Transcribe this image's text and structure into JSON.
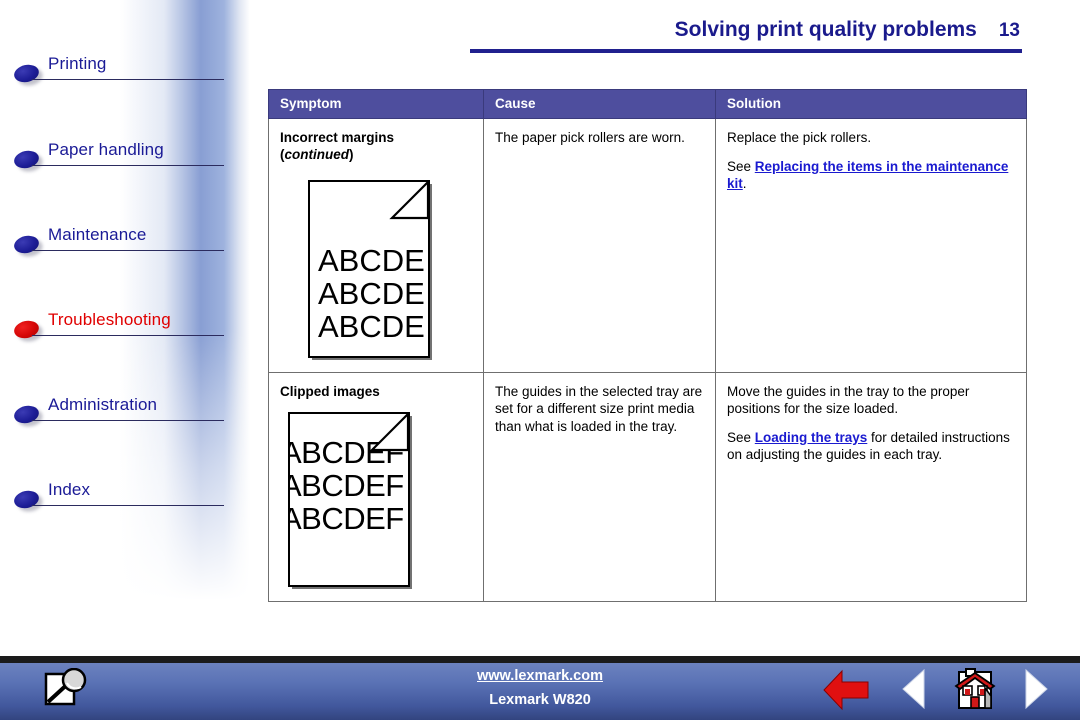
{
  "header": {
    "title": "Solving print quality problems",
    "page_number": "13",
    "accent_color": "#1a1a8c"
  },
  "sidebar": {
    "items": [
      {
        "label": "Printing",
        "state": "normal",
        "icon": "bullet-ellipse-icon"
      },
      {
        "label": "Paper handling",
        "state": "normal",
        "icon": "bullet-ellipse-icon"
      },
      {
        "label": "Maintenance",
        "state": "normal",
        "icon": "bullet-ellipse-icon"
      },
      {
        "label": "Troubleshooting",
        "state": "active",
        "icon": "bullet-ellipse-icon"
      },
      {
        "label": "Administration",
        "state": "normal",
        "icon": "bullet-ellipse-icon"
      },
      {
        "label": "Index",
        "state": "normal",
        "icon": "bullet-ellipse-icon"
      }
    ],
    "normal_color": "#1a1a96",
    "active_color": "#e00000"
  },
  "table": {
    "header_bg": "#4e4e9e",
    "columns": [
      "Symptom",
      "Cause",
      "Solution"
    ],
    "rows": [
      {
        "symptom_title": "Incorrect margins",
        "symptom_title_note": "continued",
        "sample_lines": [
          "ABCDE",
          "ABCDE",
          "ABCDE"
        ],
        "cause": "The paper pick rollers are worn.",
        "solution_text": "Replace the pick rollers.",
        "solution_see_prefix": "See ",
        "solution_link": "Replacing the items in the maintenance kit",
        "solution_see_suffix": "."
      },
      {
        "symptom_title": "Clipped images",
        "symptom_title_note": "",
        "sample_lines": [
          "ABCDEF",
          "ABCDEF",
          "ABCDEF"
        ],
        "cause": "The guides in the selected tray are set for a different size print media than what is loaded in the tray.",
        "solution_text": "Move the guides in the tray to the proper positions for the size loaded.",
        "solution_see_prefix": "See ",
        "solution_link": "Loading the trays",
        "solution_see_suffix": " for detailed instructions on adjusting the guides in each tray."
      }
    ]
  },
  "footer": {
    "url": "www.lexmark.com",
    "model": "Lexmark W820",
    "buttons": [
      {
        "name": "search",
        "icon": "magnifier-page-icon"
      },
      {
        "name": "back",
        "icon": "left-arrow-red-icon"
      },
      {
        "name": "previous-page",
        "icon": "triangle-left-icon"
      },
      {
        "name": "home",
        "icon": "house-icon"
      },
      {
        "name": "next-page",
        "icon": "triangle-right-icon"
      }
    ]
  }
}
